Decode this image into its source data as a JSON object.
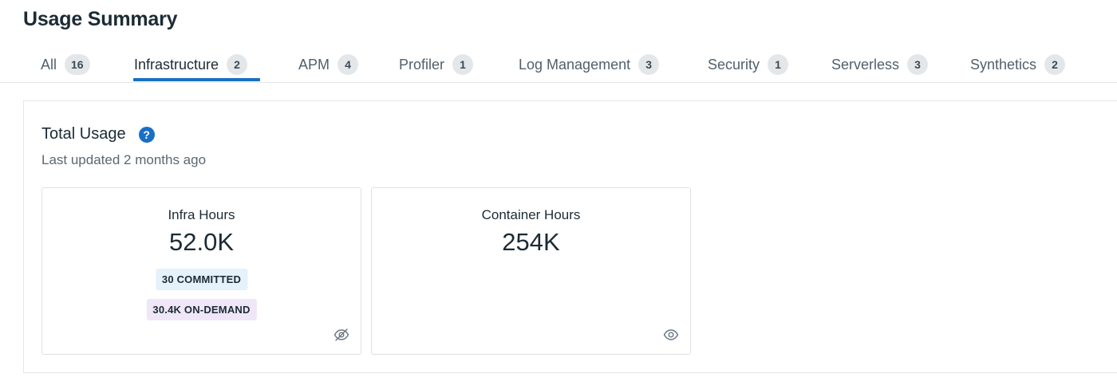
{
  "page": {
    "title": "Usage Summary"
  },
  "tabs": [
    {
      "label": "All",
      "count": "16"
    },
    {
      "label": "Infrastructure",
      "count": "2",
      "active": true
    },
    {
      "label": "APM",
      "count": "4"
    },
    {
      "label": "Profiler",
      "count": "1"
    },
    {
      "label": "Log Management",
      "count": "3"
    },
    {
      "label": "Security",
      "count": "1"
    },
    {
      "label": "Serverless",
      "count": "3"
    },
    {
      "label": "Synthetics",
      "count": "2"
    }
  ],
  "total_usage": {
    "title": "Total Usage",
    "help_icon": "?",
    "subtitle": "Last updated 2 months ago",
    "cards": [
      {
        "label": "Infra Hours",
        "value": "52.0K",
        "committed": "30 COMMITTED",
        "on_demand": "30.4K ON-DEMAND",
        "visibility_icon": "eye-slash-icon"
      },
      {
        "label": "Container Hours",
        "value": "254K",
        "visibility_icon": "eye-icon"
      }
    ]
  },
  "colors": {
    "accent": "#1a6fc4",
    "committed_bg": "#e5f1fb",
    "on_demand_bg": "#efe6f8"
  }
}
